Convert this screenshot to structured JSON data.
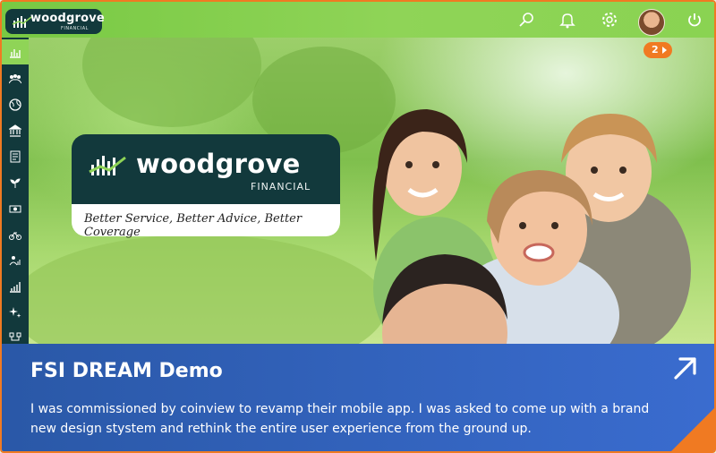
{
  "brand": {
    "name": "woodgrove",
    "sub": "FINANCIAL",
    "tagline": "Better Service, Better Advice, Better Coverage"
  },
  "topbar": {
    "icons": [
      "search-icon",
      "bell-icon",
      "gear-icon",
      "avatar",
      "power-icon"
    ]
  },
  "notification_badge": "2",
  "sidebar": {
    "items": [
      {
        "icon": "bar-chart-icon",
        "active": true
      },
      {
        "icon": "people-icon",
        "active": false
      },
      {
        "icon": "globe-icon",
        "active": false
      },
      {
        "icon": "bank-icon",
        "active": false
      },
      {
        "icon": "document-icon",
        "active": false
      },
      {
        "icon": "plant-icon",
        "active": false
      },
      {
        "icon": "cash-icon",
        "active": false
      },
      {
        "icon": "bicycle-icon",
        "active": false
      },
      {
        "icon": "person-chart-icon",
        "active": false
      },
      {
        "icon": "growth-chart-icon",
        "active": false
      },
      {
        "icon": "sparkle-icon",
        "active": false
      },
      {
        "icon": "network-icon",
        "active": false
      }
    ]
  },
  "card": {
    "title": "FSI DREAM Demo",
    "description": "I was commissioned by coinview to revamp their mobile app. I was asked to come up with a brand new design stystem and rethink the entire user experience from the ground up."
  },
  "colors": {
    "accent": "#f07a22",
    "brand_dark": "#12393c",
    "topbar_green": "#8fd457",
    "caption_blue": "#2f5fb8"
  }
}
